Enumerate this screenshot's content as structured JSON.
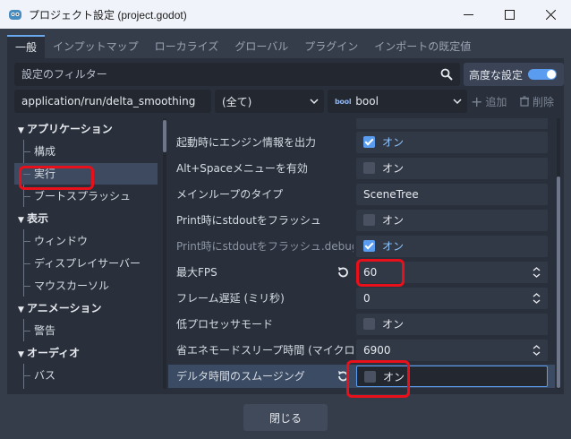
{
  "window": {
    "title": "プロジェクト設定 (project.godot)",
    "minimize_icon": "minimize-icon",
    "maximize_icon": "maximize-icon",
    "close_icon": "close-icon"
  },
  "tabs": [
    {
      "label": "一般",
      "active": true
    },
    {
      "label": "インプットマップ",
      "active": false
    },
    {
      "label": "ローカライズ",
      "active": false
    },
    {
      "label": "グローバル",
      "active": false
    },
    {
      "label": "プラグイン",
      "active": false
    },
    {
      "label": "インポートの既定値",
      "active": false
    }
  ],
  "filter": {
    "placeholder": "設定のフィルター",
    "advanced_label": "高度な設定",
    "advanced_on": true
  },
  "path_row": {
    "path_value": "application/run/delta_smoothing",
    "feature_value": "(全て)",
    "type_value": "bool",
    "add_label": "追加",
    "delete_label": "削除"
  },
  "tree": {
    "items": [
      {
        "label": "アプリケーション",
        "kind": "section"
      },
      {
        "label": "構成",
        "kind": "child"
      },
      {
        "label": "実行",
        "kind": "child",
        "selected": true
      },
      {
        "label": "ブートスプラッシュ",
        "kind": "child"
      },
      {
        "label": "表示",
        "kind": "section"
      },
      {
        "label": "ウィンドウ",
        "kind": "child"
      },
      {
        "label": "ディスプレイサーバー",
        "kind": "child"
      },
      {
        "label": "マウスカーソル",
        "kind": "child"
      },
      {
        "label": "アニメーション",
        "kind": "section"
      },
      {
        "label": "警告",
        "kind": "child"
      },
      {
        "label": "オーディオ",
        "kind": "section"
      },
      {
        "label": "バス",
        "kind": "child"
      }
    ]
  },
  "properties": [
    {
      "name": "起動時にエンジン情報を出力",
      "type": "check",
      "checked": true,
      "label": "オン"
    },
    {
      "name": "Alt+Spaceメニューを有効",
      "type": "check",
      "checked": false,
      "label": "オン"
    },
    {
      "name": "メインループのタイプ",
      "type": "text",
      "value": "SceneTree"
    },
    {
      "name": "Print時にstdoutをフラッシュ",
      "type": "check",
      "checked": false,
      "label": "オン"
    },
    {
      "name": "Print時にstdoutをフラッシュ.debug",
      "type": "check",
      "checked": true,
      "label": "オン",
      "dim": true
    },
    {
      "name": "最大FPS",
      "type": "spin",
      "value": "60",
      "revert": true
    },
    {
      "name": "フレーム遅延 (ミリ秒)",
      "type": "spin",
      "value": "0"
    },
    {
      "name": "低プロセッサモード",
      "type": "check",
      "checked": false,
      "label": "オン"
    },
    {
      "name": "省エネモードスリープ時間 (マイクロ",
      "type": "spin",
      "value": "6900"
    },
    {
      "name": "デルタ時間のスムージング",
      "type": "check",
      "checked": false,
      "label": "オン",
      "revert": true,
      "highlight": true
    }
  ],
  "footer": {
    "close_label": "閉じる"
  },
  "colors": {
    "accent": "#5a9cf0",
    "annotation": "#e8101a"
  }
}
